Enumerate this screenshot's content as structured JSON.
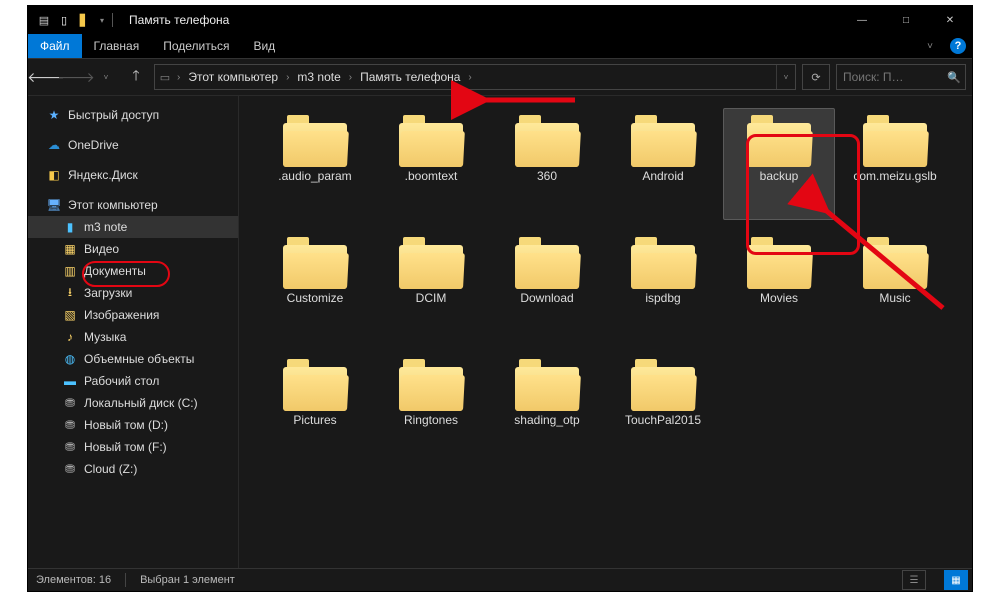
{
  "window": {
    "title": "Память телефона"
  },
  "ribbon": {
    "file": "Файл",
    "home": "Главная",
    "share": "Поделиться",
    "view": "Вид"
  },
  "breadcrumbs": [
    "Этот компьютер",
    "m3 note",
    "Память телефона"
  ],
  "search": {
    "placeholder": "Поиск: П…"
  },
  "sidebar": {
    "quick_access": "Быстрый доступ",
    "onedrive": "OneDrive",
    "yandex_disk": "Яндекс.Диск",
    "this_pc": "Этот компьютер",
    "m3_note": "m3 note",
    "video": "Видео",
    "documents": "Документы",
    "downloads": "Загрузки",
    "pictures": "Изображения",
    "music": "Музыка",
    "objects3d": "Объемные объекты",
    "desktop": "Рабочий стол",
    "local_c": "Локальный диск (C:)",
    "new_d": "Новый том (D:)",
    "new_f": "Новый том (F:)",
    "cloud_z": "Cloud (Z:)"
  },
  "folders": [
    ".audio_param",
    ".boomtext",
    "360",
    "Android",
    "backup",
    "com.meizu.gslb",
    "Customize",
    "DCIM",
    "Download",
    "ispdbg",
    "Movies",
    "Music",
    "Pictures",
    "Ringtones",
    "shading_otp",
    "TouchPal2015"
  ],
  "selected_folder_index": 4,
  "status": {
    "count_label": "Элементов: 16",
    "selection_label": "Выбран 1 элемент"
  }
}
